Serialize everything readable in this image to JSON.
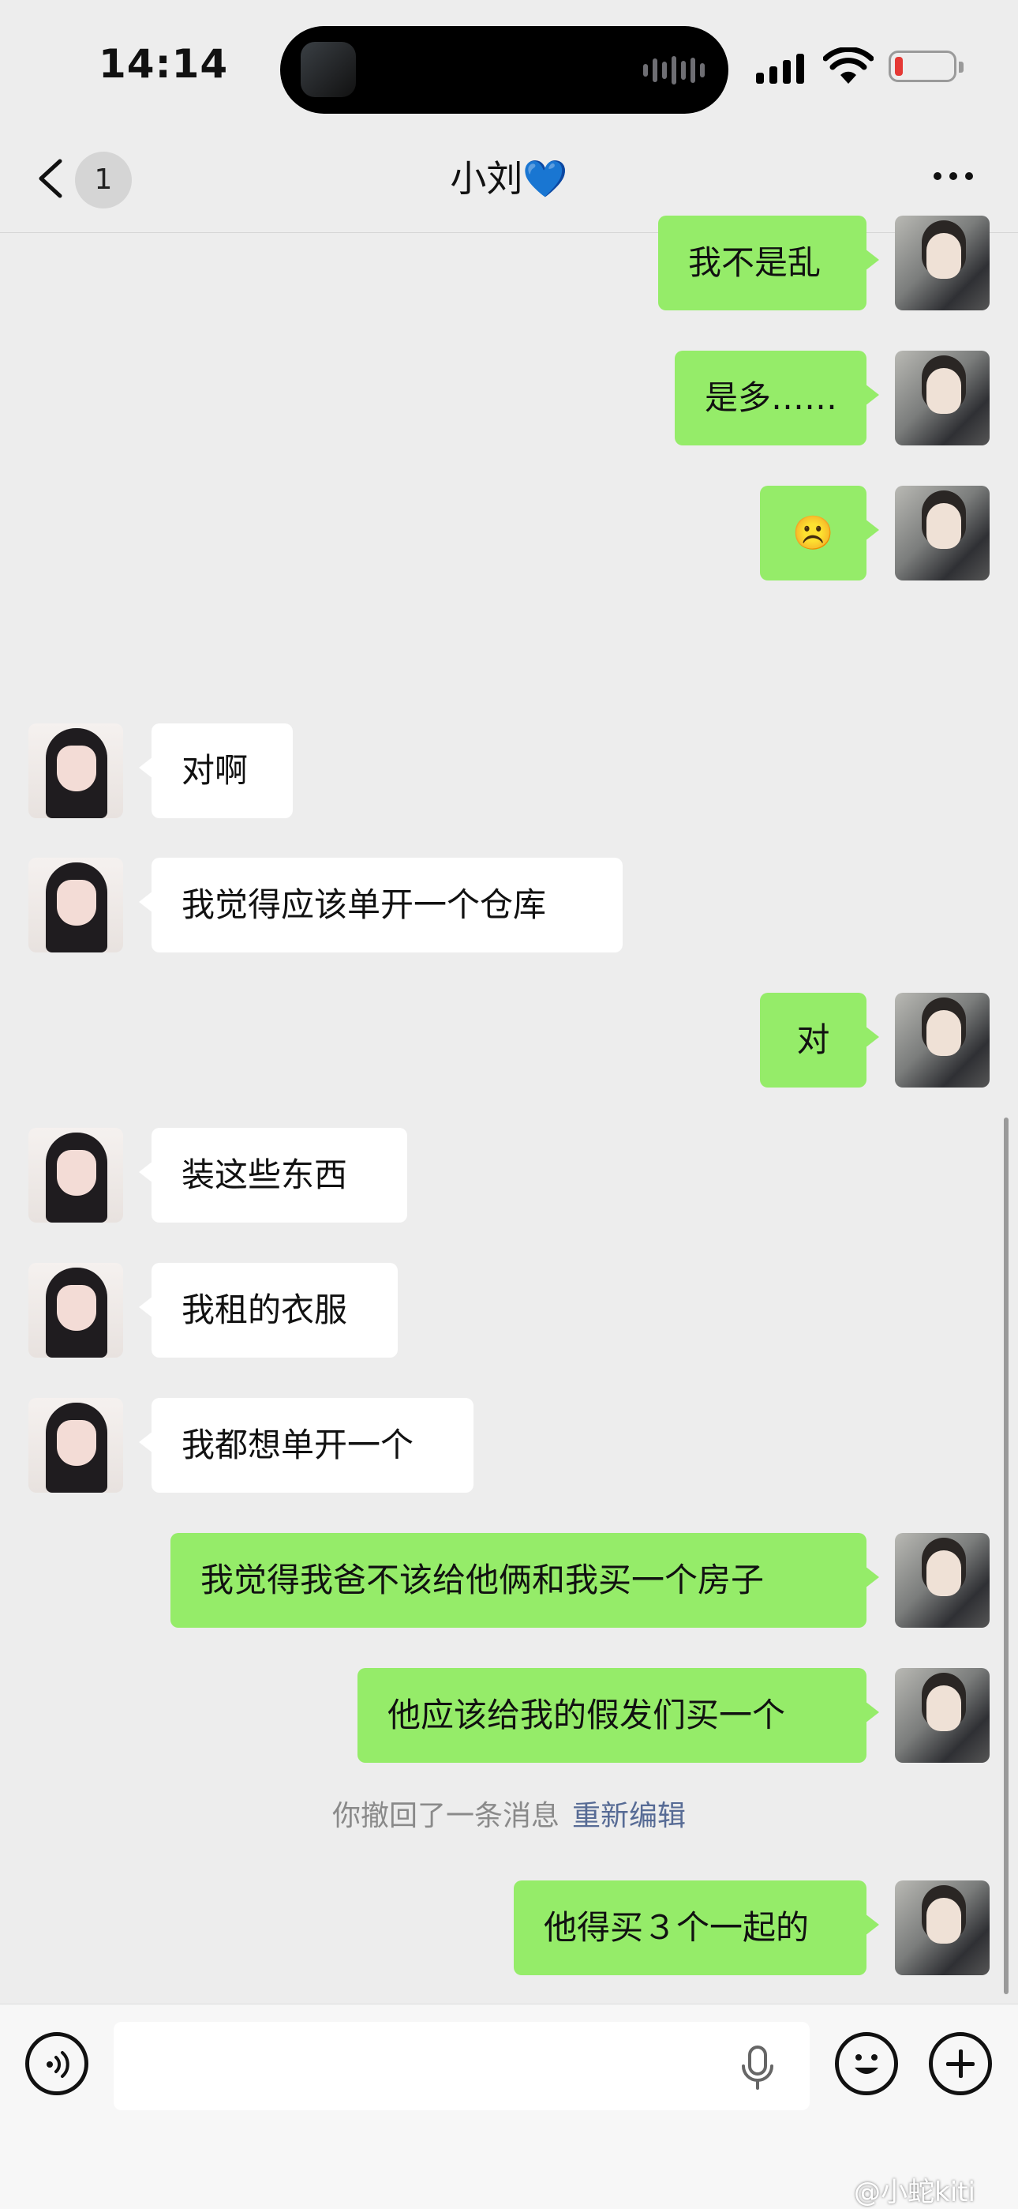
{
  "status_bar": {
    "time": "14:14"
  },
  "nav": {
    "unread_badge": "1",
    "title": "小刘💙"
  },
  "messages": [
    {
      "sender": "me",
      "text": "我不是乱"
    },
    {
      "sender": "me",
      "text": "是多……"
    },
    {
      "sender": "me",
      "text": "☹️"
    },
    {
      "sender": "her",
      "text": "对啊"
    },
    {
      "sender": "her",
      "text": "我觉得应该单开一个仓库"
    },
    {
      "sender": "me",
      "text": "对"
    },
    {
      "sender": "her",
      "text": "装这些东西"
    },
    {
      "sender": "her",
      "text": "我租的衣服"
    },
    {
      "sender": "her",
      "text": "我都想单开一个"
    },
    {
      "sender": "me",
      "text": "我觉得我爸不该给他俩和我买一个房子"
    },
    {
      "sender": "me",
      "text": "他应该给我的假发们买一个"
    },
    {
      "sender": "me",
      "text": "他得买３个一起的"
    }
  ],
  "recall_notice": {
    "text": "你撤回了一条消息",
    "action": "重新编辑"
  },
  "watermark": "@小蛇kiti",
  "colors": {
    "my_bubble": "#95ec69",
    "her_bubble": "#ffffff",
    "background": "#ededed",
    "link": "#576b95"
  }
}
